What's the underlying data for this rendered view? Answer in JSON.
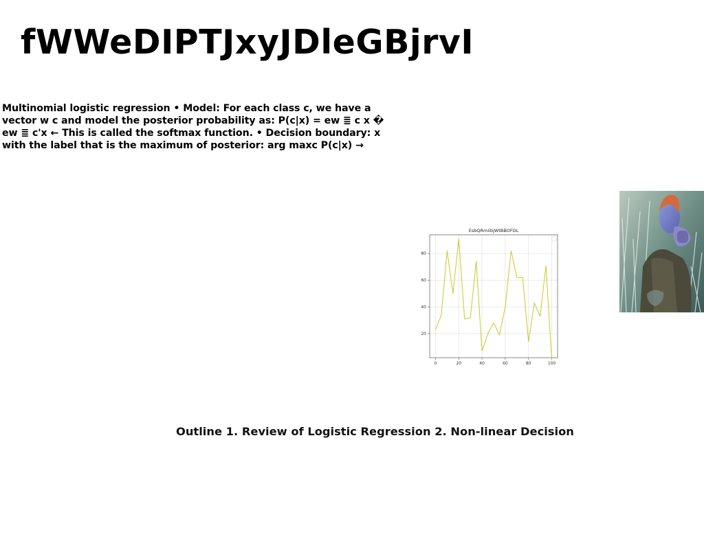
{
  "slide": {
    "title": "fWWeDIPTJxyJDleGBjrvI",
    "body_text": "Multinomial logistic regression • Model: For each class c, we have a vector w c and model the posterior probability as: P(c|x) = ew ≣ c x � ew ≣ c'x ← This is called the softmax function. • Decision boundary: x with the label that is the maximum of posterior: arg maxc P(c|x) →",
    "caption": "Outline 1. Review of Logistic Regression 2. Non-linear Decision"
  },
  "photo": {
    "description_icon": "person-portrait-photo"
  },
  "colors": {
    "line": "#c8c82a",
    "grid": "#dcdcdc",
    "axis": "#555555"
  },
  "chart_data": {
    "type": "line",
    "title": "EsbQRmiibjWtBBOFDL",
    "xlabel": "",
    "ylabel": "",
    "xlim": [
      -5,
      105
    ],
    "ylim": [
      2,
      94
    ],
    "xticks": [
      0,
      20,
      40,
      60,
      80,
      100
    ],
    "yticks": [
      20,
      40,
      60,
      80
    ],
    "grid": true,
    "legend": "top-right",
    "series": [
      {
        "x": [
          0,
          5,
          10,
          15,
          20,
          25,
          30,
          35,
          40,
          45,
          50,
          55,
          60,
          65,
          70,
          75,
          80,
          85,
          90,
          95,
          100
        ],
        "values": [
          23,
          34,
          82,
          50,
          91,
          31,
          32,
          74,
          7,
          20,
          28,
          19,
          40,
          82,
          62,
          62,
          14,
          43,
          33,
          71,
          0
        ]
      }
    ]
  }
}
